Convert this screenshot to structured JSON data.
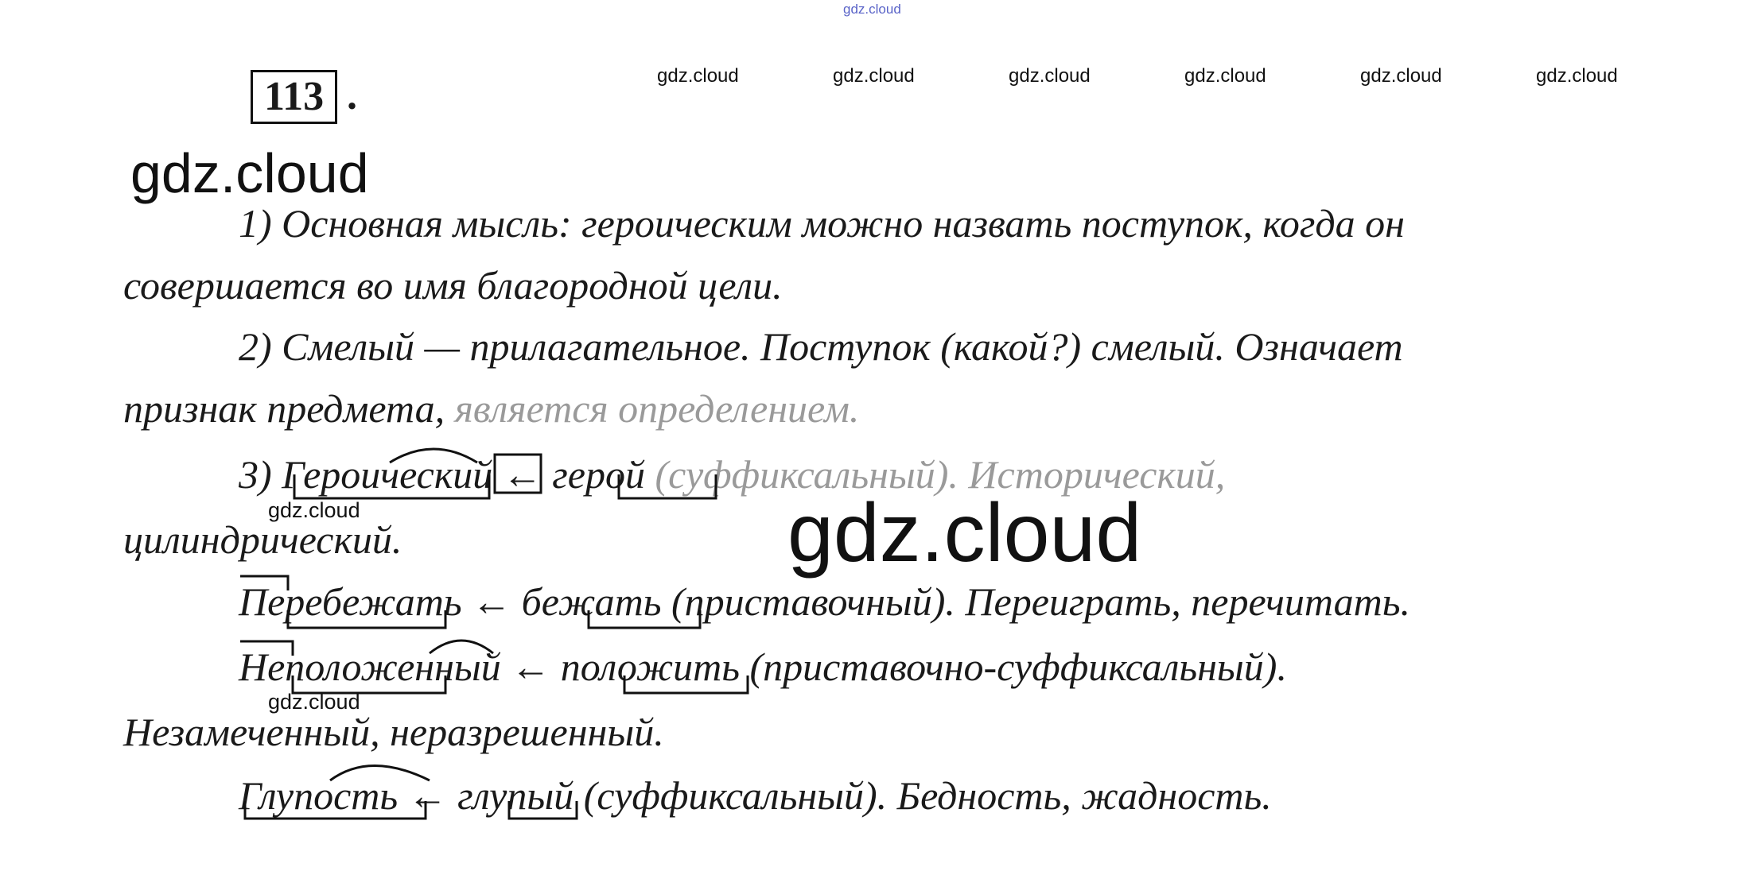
{
  "watermarks": {
    "top": "gdz.cloud",
    "row": [
      "gdz.cloud",
      "gdz.cloud",
      "gdz.cloud",
      "gdz.cloud",
      "gdz.cloud",
      "gdz.cloud"
    ],
    "big_upper": "gdz.cloud",
    "big_center": "gdz.cloud",
    "small_1": "gdz.cloud",
    "small_2": "gdz.cloud"
  },
  "task": {
    "number": "113",
    "dot": "."
  },
  "lines": [
    "1) Основная мысль: героическим можно назвать поступок, когда он",
    "совершается во имя благородной цели.",
    "2) Смелый — прилагательное. Поступок (какой?) смелый. Означает",
    "признак предмета, является определением.",
    "3) Героический ← герой (суффиксальный). Исторический,",
    "цилиндрический.",
    "Перебежать ← бежать (приставочный). Переиграть, перечитать.",
    "Неположенный ← положить (приставочно-суффиксальный).",
    "Незамеченный, неразрешенный.",
    "Глупость ← глупый (суффиксальный). Бедность, жадность."
  ],
  "line4_parts": {
    "normal": "признак предмета,",
    "faded": " является определением."
  },
  "line5_parts": {
    "normal": "3) Героический ← герой",
    "faded": " (суффиксальный). Исторический,"
  }
}
